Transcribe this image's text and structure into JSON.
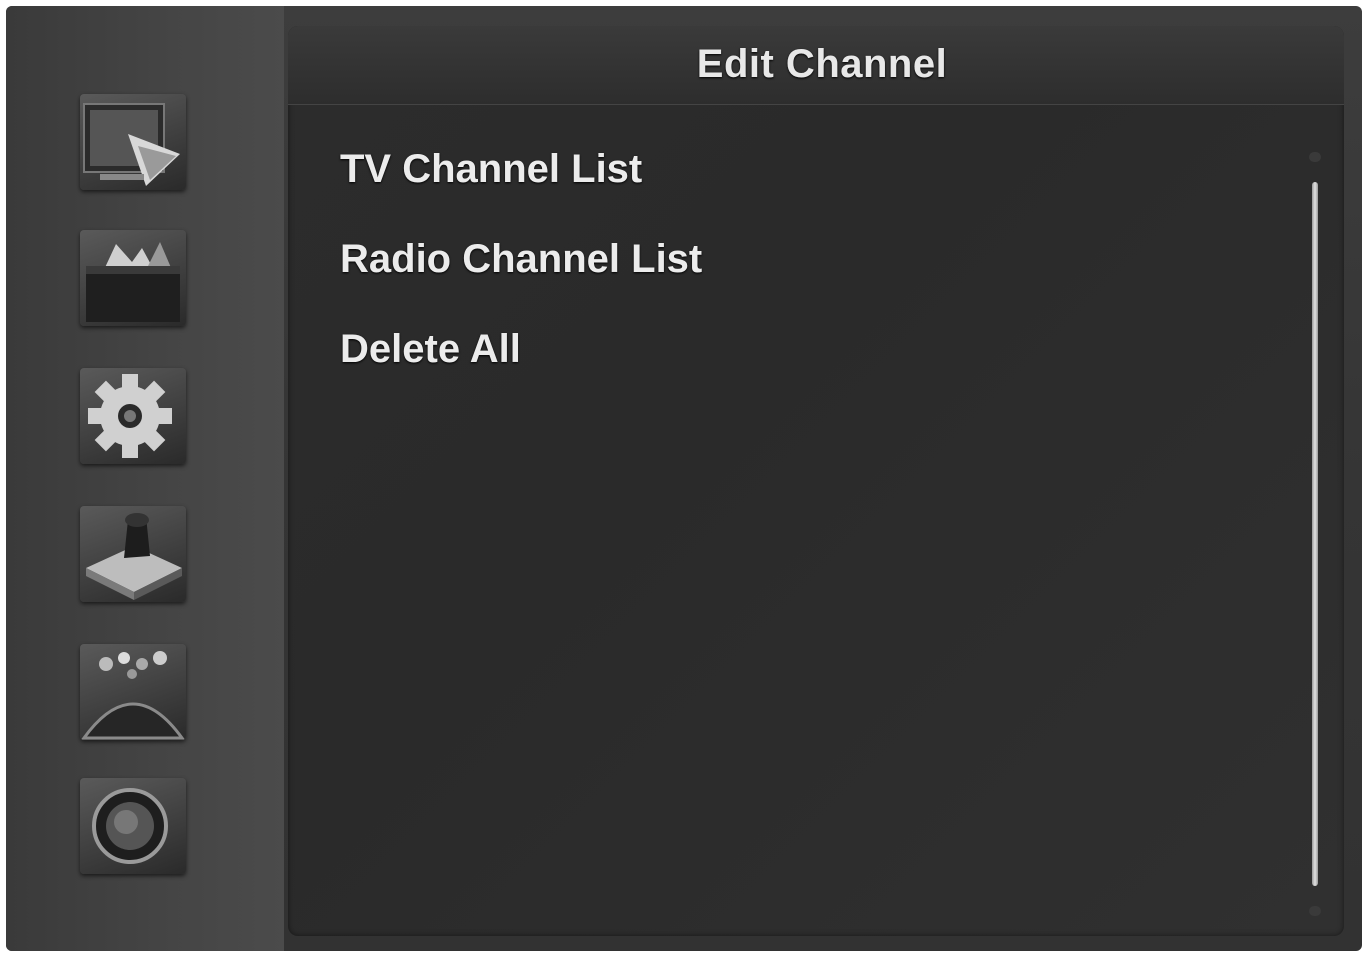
{
  "header": {
    "title": "Edit Channel"
  },
  "sidebar": {
    "items": [
      {
        "icon": "satellite-tv-icon"
      },
      {
        "icon": "media-folder-icon"
      },
      {
        "icon": "gear-icon"
      },
      {
        "icon": "joystick-icon"
      },
      {
        "icon": "gamepad-icon"
      },
      {
        "icon": "power-button-icon"
      }
    ]
  },
  "menu": {
    "items": [
      {
        "label": "TV Channel List"
      },
      {
        "label": "Radio Channel List"
      },
      {
        "label": "Delete All"
      }
    ]
  }
}
